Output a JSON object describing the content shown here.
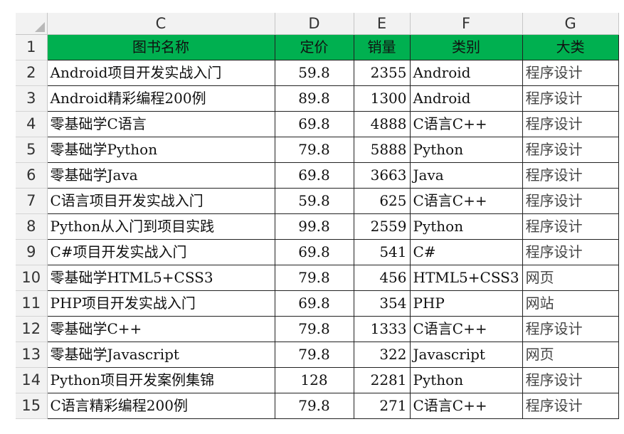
{
  "spreadsheet": {
    "column_headers": [
      "C",
      "D",
      "E",
      "F",
      "G"
    ],
    "header_fill": "#00b050",
    "header_row": {
      "row_number": "1",
      "cells": [
        "图书名称",
        "定价",
        "销量",
        "类别",
        "大类"
      ]
    },
    "rows": [
      {
        "row_number": "2",
        "cells": [
          "Android项目开发实战入门",
          "59.8",
          "2355",
          "Android",
          "程序设计"
        ]
      },
      {
        "row_number": "3",
        "cells": [
          "Android精彩编程200例",
          "89.8",
          "1300",
          "Android",
          "程序设计"
        ]
      },
      {
        "row_number": "4",
        "cells": [
          "零基础学C语言",
          "69.8",
          "4888",
          "C语言C++",
          "程序设计"
        ]
      },
      {
        "row_number": "5",
        "cells": [
          "零基础学Python",
          "79.8",
          "5888",
          "Python",
          "程序设计"
        ]
      },
      {
        "row_number": "6",
        "cells": [
          "零基础学Java",
          "69.8",
          "3663",
          "Java",
          "程序设计"
        ]
      },
      {
        "row_number": "7",
        "cells": [
          "C语言项目开发实战入门",
          "59.8",
          "625",
          "C语言C++",
          "程序设计"
        ]
      },
      {
        "row_number": "8",
        "cells": [
          "Python从入门到项目实践",
          "99.8",
          "2559",
          "Python",
          "程序设计"
        ]
      },
      {
        "row_number": "9",
        "cells": [
          "C#项目开发实战入门",
          "69.8",
          "541",
          "C#",
          "程序设计"
        ]
      },
      {
        "row_number": "10",
        "cells": [
          "零基础学HTML5+CSS3",
          "79.8",
          "456",
          "HTML5+CSS3",
          "网页"
        ]
      },
      {
        "row_number": "11",
        "cells": [
          "PHP项目开发实战入门",
          "69.8",
          "354",
          "PHP",
          "网站"
        ]
      },
      {
        "row_number": "12",
        "cells": [
          "零基础学C++",
          "79.8",
          "1333",
          "C语言C++",
          "程序设计"
        ]
      },
      {
        "row_number": "13",
        "cells": [
          "零基础学Javascript",
          "79.8",
          "322",
          "Javascript",
          "网页"
        ]
      },
      {
        "row_number": "14",
        "cells": [
          "Python项目开发案例集锦",
          "128",
          "2281",
          "Python",
          "程序设计"
        ]
      },
      {
        "row_number": "15",
        "cells": [
          "C语言精彩编程200例",
          "79.8",
          "271",
          "C语言C++",
          "程序设计"
        ]
      }
    ]
  }
}
